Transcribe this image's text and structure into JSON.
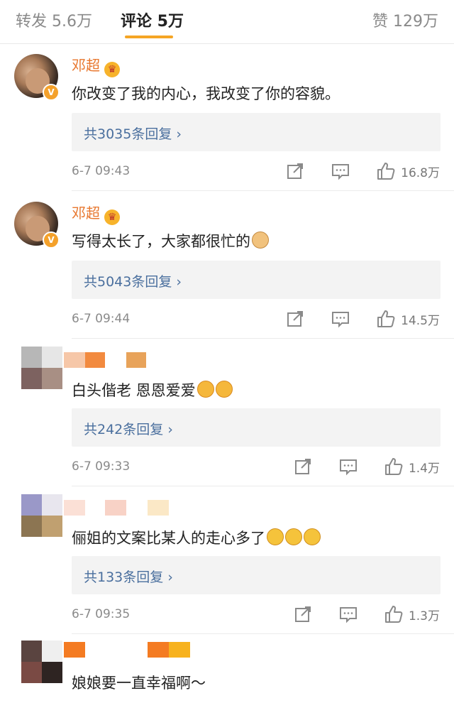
{
  "tabs": {
    "repost": "转发 5.6万",
    "comments": "评论 5万",
    "likes": "赞 129万"
  },
  "comments": [
    {
      "username": "邓超",
      "text": "你改变了我的内心，我改变了你的容貌。",
      "replies": "共3035条回复",
      "time": "6-7 09:43",
      "likes": "16.8万"
    },
    {
      "username": "邓超",
      "text": "写得太长了，大家都很忙的",
      "replies": "共5043条回复",
      "time": "6-7 09:44",
      "likes": "14.5万"
    },
    {
      "username": "",
      "text": "白头偕老 恩恩爱爱",
      "replies": "共242条回复",
      "time": "6-7 09:33",
      "likes": "1.4万"
    },
    {
      "username": "",
      "text": "俪姐的文案比某人的走心多了",
      "replies": "共133条回复",
      "time": "6-7 09:35",
      "likes": "1.3万"
    },
    {
      "username": "",
      "text": "娘娘要一直幸福啊～"
    }
  ],
  "icons": {
    "repost": "repost-icon",
    "comment": "comment-icon",
    "like": "thumbs-up-icon",
    "chevron": "chevron-right-icon",
    "crown": "crown-icon",
    "verified": "verified-badge-icon"
  },
  "colors": {
    "accent": "#f5a524",
    "username": "#e8772e",
    "link": "#4a6f9e",
    "muted": "#8a8a8a"
  }
}
